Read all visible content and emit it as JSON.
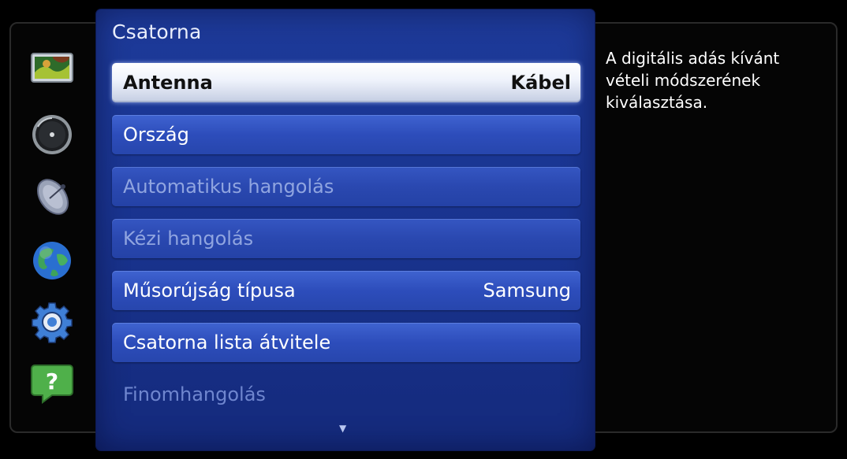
{
  "menu": {
    "title": "Csatorna",
    "items": [
      {
        "label": "Antenna",
        "value": "Kábel"
      },
      {
        "label": "Ország",
        "value": ""
      },
      {
        "label": "Automatikus hangolás",
        "value": ""
      },
      {
        "label": "Kézi hangolás",
        "value": ""
      },
      {
        "label": "Műsorújság típusa",
        "value": "Samsung"
      },
      {
        "label": "Csatorna lista átvitele",
        "value": ""
      },
      {
        "label": "Finomhangolás",
        "value": ""
      }
    ],
    "scroll_indicator": "▼"
  },
  "help": {
    "text": "A digitális adás kívánt vételi módszerének kiválasztása."
  },
  "side_icons": [
    "picture-icon",
    "sound-icon",
    "channel-satellite-icon",
    "network-globe-icon",
    "system-gear-icon",
    "support-help-icon"
  ],
  "colors": {
    "panel": "#1a3592",
    "item": "#2d4dbb",
    "selected": "#eef2fb"
  }
}
